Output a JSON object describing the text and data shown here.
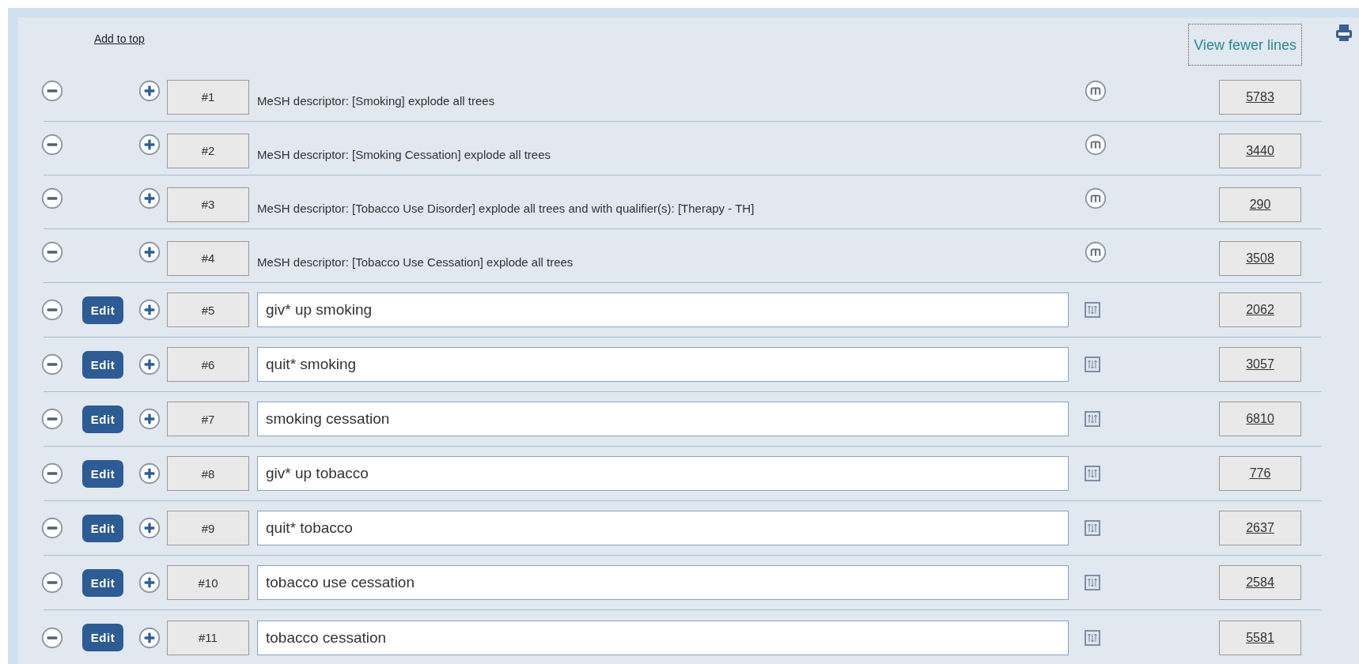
{
  "add_to_top": "Add to top",
  "view_lines": "View fewer lines",
  "lines": [
    {
      "kind": "mesh",
      "number": "#1",
      "text": "MeSH descriptor: [Smoking] explode all trees",
      "count": "5783"
    },
    {
      "kind": "mesh",
      "number": "#2",
      "text": "MeSH descriptor: [Smoking Cessation] explode all trees",
      "count": "3440"
    },
    {
      "kind": "mesh",
      "number": "#3",
      "text": "MeSH descriptor: [Tobacco Use Disorder] explode all trees and with qualifier(s): [Therapy - TH]",
      "count": "290"
    },
    {
      "kind": "mesh",
      "number": "#4",
      "text": "MeSH descriptor: [Tobacco Use Cessation] explode all trees",
      "count": "3508"
    },
    {
      "kind": "search",
      "number": "#5",
      "edit": "Edit",
      "value": "giv* up smoking",
      "count": "2062"
    },
    {
      "kind": "search",
      "number": "#6",
      "edit": "Edit",
      "value": "quit* smoking",
      "count": "3057"
    },
    {
      "kind": "search",
      "number": "#7",
      "edit": "Edit",
      "value": "smoking cessation",
      "count": "6810"
    },
    {
      "kind": "search",
      "number": "#8",
      "edit": "Edit",
      "value": "giv* up tobacco",
      "count": "776"
    },
    {
      "kind": "search",
      "number": "#9",
      "edit": "Edit",
      "value": "quit* tobacco",
      "count": "2637"
    },
    {
      "kind": "search",
      "number": "#10",
      "edit": "Edit",
      "value": "tobacco use cessation",
      "count": "2584"
    },
    {
      "kind": "search",
      "number": "#11",
      "edit": "Edit",
      "value": "tobacco cessation",
      "count": "5581"
    }
  ]
}
